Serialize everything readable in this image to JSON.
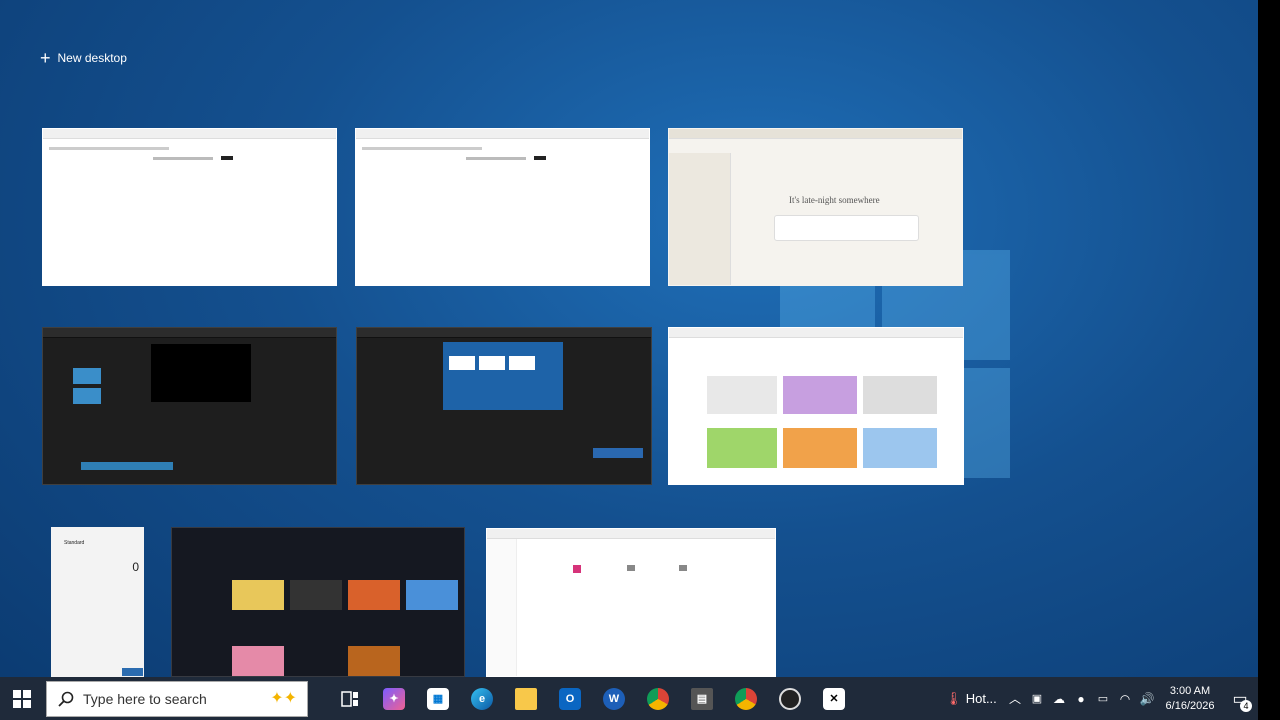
{
  "new_desktop": {
    "label": "New desktop"
  },
  "windows": [
    {
      "name": "browser-window-blank-1"
    },
    {
      "name": "browser-window-blank-2"
    },
    {
      "name": "browser-window-claude",
      "heading": "It's late-night somewhere"
    },
    {
      "name": "video-editor-window"
    },
    {
      "name": "obs-studio-window"
    },
    {
      "name": "youtube-browser-window"
    },
    {
      "name": "calculator-window",
      "mode": "Standard",
      "display": "0"
    },
    {
      "name": "media-feed-window"
    },
    {
      "name": "file-explorer-window"
    }
  ],
  "taskbar": {
    "search_placeholder": "Type here to search",
    "weather_label": "Hot...",
    "time": "3:00 AM",
    "date": "6/16/2026",
    "notification_count": "4"
  }
}
